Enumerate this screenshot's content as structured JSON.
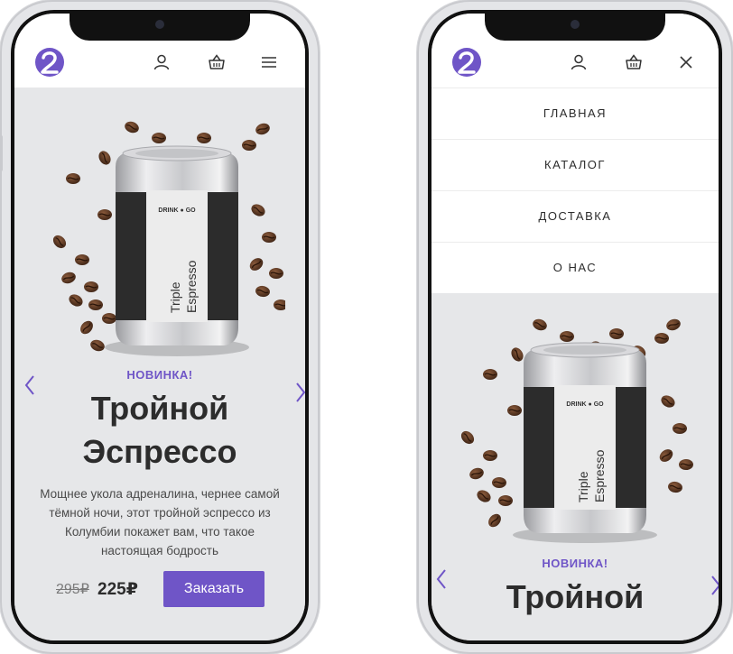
{
  "brand": {
    "accent": "#6f55c7",
    "logo_glyph": "2"
  },
  "icons": {
    "user": "user-icon",
    "cart": "basket-icon",
    "menu": "hamburger-icon",
    "close": "close-icon",
    "prev": "chevron-left-icon",
    "next": "chevron-right-icon"
  },
  "product": {
    "badge": "НОВИНКА!",
    "title_line1": "Тройной",
    "title_line2": "Эспрессо",
    "description": "Мощнее укола адреналина, чернее самой тёмной ночи, этот тройной эспрессо из Колумбии покажет вам, что такое настоящая бодрость",
    "old_price": "295₽",
    "new_price": "225₽",
    "order_label": "Заказать",
    "can_brand_left": "DRINK",
    "can_brand_right": "GO",
    "can_label_line1": "Triple",
    "can_label_line2": "Espresso"
  },
  "menu": {
    "items": [
      {
        "label": "ГЛАВНАЯ"
      },
      {
        "label": "КАТАЛОГ"
      },
      {
        "label": "ДОСТАВКА"
      },
      {
        "label": "О НАС"
      }
    ]
  }
}
